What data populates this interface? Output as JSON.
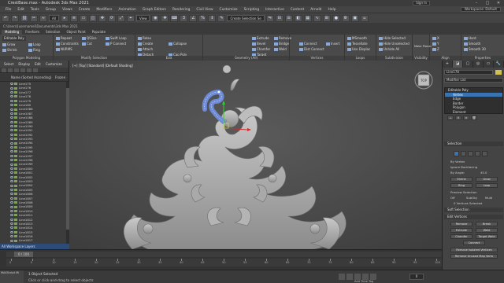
{
  "app": {
    "title": "CrestBase.max - Autodesk 3ds Max 2021",
    "sign_in": "Sign In",
    "workspace": "Workspaces: Default",
    "window_controls": [
      "–",
      "□",
      "✕"
    ]
  },
  "menubar": [
    "File",
    "Edit",
    "Tools",
    "Group",
    "Views",
    "Create",
    "Modifiers",
    "Animation",
    "Graph Editors",
    "Rendering",
    "Civil View",
    "Customize",
    "Scripting",
    "Interactive",
    "Content",
    "Arnold",
    "Help"
  ],
  "toolbar": {
    "filter_value": "All",
    "view_value": "View",
    "selection_set_placeholder": "Create Selection Se"
  },
  "path": "C:\\Users\\[username]\\Documents\\3ds Max 2021",
  "ribbon": {
    "tabs": [
      "Modeling",
      "Freeform",
      "Selection",
      "Object Paint",
      "Populate"
    ],
    "active_tab": "Modeling",
    "groups": [
      {
        "caption": "Polygon Modeling",
        "buttons": [
          "Editable Poly",
          "Grow",
          "Shrink",
          "Loop",
          "Ring"
        ]
      },
      {
        "caption": "Modify Selection",
        "buttons": [
          "Repeat",
          "QSlice",
          "Swift Loop",
          "Cut",
          "NURMS",
          "Constraints",
          "P Connect"
        ]
      },
      {
        "caption": "Edit",
        "buttons": [
          "Relax",
          "Create",
          "Attach",
          "Collapse",
          "Detach",
          "Cap Poly"
        ]
      },
      {
        "caption": "Geometry (All)",
        "buttons": [
          "Extrude",
          "Remove",
          "Bevel",
          "Chamfer",
          "Bridge",
          "Weld",
          "Target"
        ]
      },
      {
        "caption": "Vertices",
        "buttons": [
          "Connect",
          "Insert",
          "Dist Connect"
        ]
      },
      {
        "caption": "Loops",
        "buttons": [
          "MSmooth",
          "Tessellate",
          "Use Displac"
        ]
      },
      {
        "caption": "Subdivision",
        "buttons": [
          "Hide Selected",
          "Hide Unselected",
          "Unhide All"
        ]
      },
      {
        "caption": "Visibility",
        "buttons": [
          "Make Planar"
        ]
      },
      {
        "caption": "Align",
        "buttons": [
          "X",
          "Y",
          "Z"
        ]
      },
      {
        "caption": "Properties",
        "buttons": [
          "Hard",
          "Smooth",
          "Smooth 30"
        ]
      }
    ]
  },
  "explorer": {
    "tabs": [
      "Select",
      "Display",
      "Edit",
      "Customize"
    ],
    "column_header": "Name (Sorted Ascending)",
    "column_right": "Frozen",
    "rows": [
      "Line175",
      "Line176",
      "Line177",
      "Line178",
      "Line179",
      "Line180",
      "Line1086",
      "Line1087",
      "Line1088",
      "Line1089",
      "Line1090",
      "Line1091",
      "Line1092",
      "Line1093",
      "Line1094",
      "Line1095",
      "Line1096",
      "Line1097",
      "Line1098",
      "Line1099",
      "Line1800",
      "Line1801",
      "Line1802",
      "Line1803",
      "Line1804",
      "Line1805",
      "Line1806",
      "Line1807",
      "Line1808",
      "Line1809",
      "Line1810",
      "Line1811",
      "Line1812",
      "Line1813",
      "Line1814",
      "Line1815",
      "Line1816",
      "Line1817"
    ],
    "footer": "All Workspace Layers"
  },
  "viewport": {
    "label": "[+] [Top] [Standard] [Default Shading]"
  },
  "command_panel": {
    "tabs": [
      "+",
      "◪",
      "▢",
      "◎",
      "▭",
      "🔧"
    ],
    "object_name": "Line178",
    "modifier_list": "Modifier List",
    "swatch_color": "#d0c050",
    "stack": {
      "root": "Editable Poly",
      "subs": [
        "Vertex",
        "Edge",
        "Border",
        "Polygon",
        "Element"
      ],
      "selected": "Vertex"
    },
    "selection": {
      "title": "Selection",
      "by_vertex": "By Vertex",
      "ignore_backfacing": "Ignore Backfacing",
      "by_angle": "By Angle:",
      "angle_value": "45.0",
      "shrink": "Shrink",
      "grow": "Grow",
      "ring": "Ring",
      "loop": "Loop",
      "preview": "Preview Selection",
      "preview_opts": [
        "Off",
        "SubObj",
        "Multi"
      ],
      "status": "0 Vertices Selected"
    },
    "soft_selection": "Soft Selection",
    "edit_vertices": {
      "title": "Edit Vertices",
      "buttons": [
        "Remove",
        "Break",
        "Extrude",
        "Weld",
        "Chamfer",
        "Target Weld",
        "Connect",
        "Remove Isolated Vertices",
        "Remove Unused Map Verts"
      ]
    }
  },
  "timeline": {
    "slider": "0 / 100",
    "ticks": [
      "0",
      "5",
      "10",
      "15",
      "20",
      "25",
      "30",
      "35",
      "40",
      "45",
      "50",
      "55",
      "60",
      "65",
      "70",
      "75",
      "80",
      "85",
      "90",
      "95",
      "100"
    ]
  },
  "status": {
    "script_label": "MAXScript Mi",
    "line1": "1 Object Selected",
    "line2": "Click or click-and-drag to select objects",
    "add_tag": "Add Time Tag",
    "frame": "0"
  }
}
